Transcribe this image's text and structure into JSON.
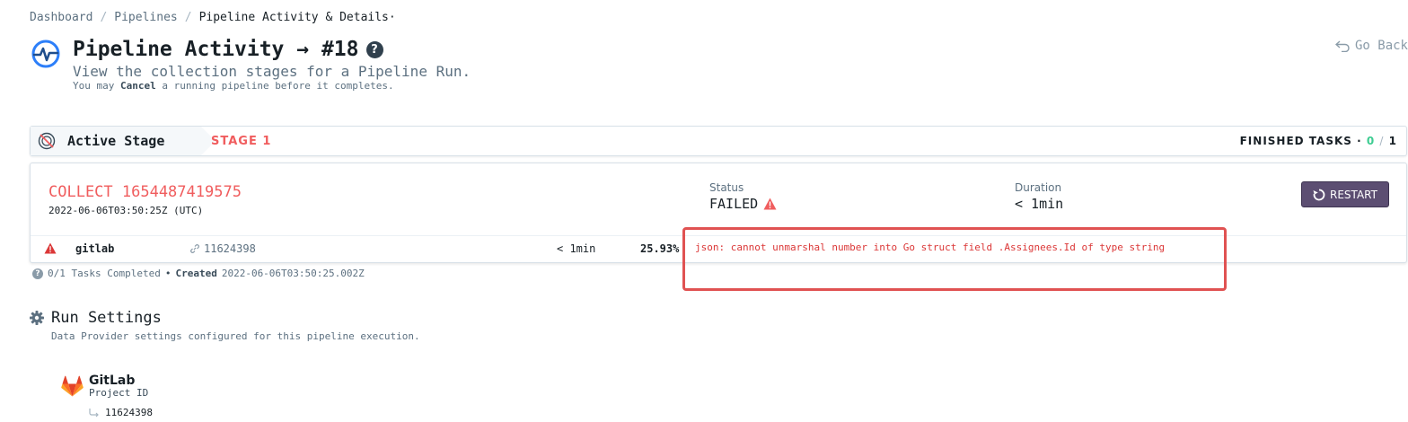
{
  "breadcrumb": {
    "items": [
      "Dashboard",
      "Pipelines",
      "Pipeline Activity & Details·"
    ],
    "separator": "/"
  },
  "header": {
    "title": "Pipeline Activity → #18",
    "subtitle": "View the collection stages for a Pipeline Run.",
    "hint_prefix": "You may",
    "hint_bold": "Cancel",
    "hint_suffix": "a running pipeline before it completes.",
    "go_back": "Go Back"
  },
  "stage_bar": {
    "active_label": "Active Stage",
    "stage_name": "STAGE 1",
    "finished_label": "FINISHED TASKS ·",
    "finished_done": "0",
    "finished_sep": "/",
    "finished_total": "1"
  },
  "run": {
    "title": "COLLECT 1654487419575",
    "timestamp": "2022-06-06T03:50:25Z (UTC)",
    "status_label": "Status",
    "status_value": "FAILED",
    "duration_label": "Duration",
    "duration_value": "< 1min",
    "restart_label": "RESTART",
    "task": {
      "name": "gitlab",
      "link": "11624398",
      "duration": "< 1min",
      "progress": "25.93%",
      "error": "json: cannot unmarshal number into Go struct field .Assignees.Id of type string"
    }
  },
  "summary": {
    "tasks": "0/1 Tasks Completed",
    "created_label": "Created",
    "created_value": "2022-06-06T03:50:25.002Z"
  },
  "settings": {
    "title": "Run Settings",
    "description": "Data Provider settings configured for this pipeline execution.",
    "provider_name": "GitLab",
    "provider_field": "Project ID",
    "provider_value": "11624398"
  },
  "colors": {
    "failed": "#f05d5e",
    "success": "#3dcc91",
    "restart_bg": "#5c4e72",
    "highlight": "#e05252"
  },
  "icons": {
    "title": "pipeline-activity-icon",
    "help": "question-circle-icon",
    "go_back": "undo-icon",
    "stage": "stage-disabled-icon",
    "warning": "warning-triangle-icon",
    "restart": "refresh-icon",
    "link": "link-icon",
    "settings": "gear-icon",
    "provider": "gitlab-logo-icon",
    "value_arrow": "corner-down-right-icon"
  }
}
